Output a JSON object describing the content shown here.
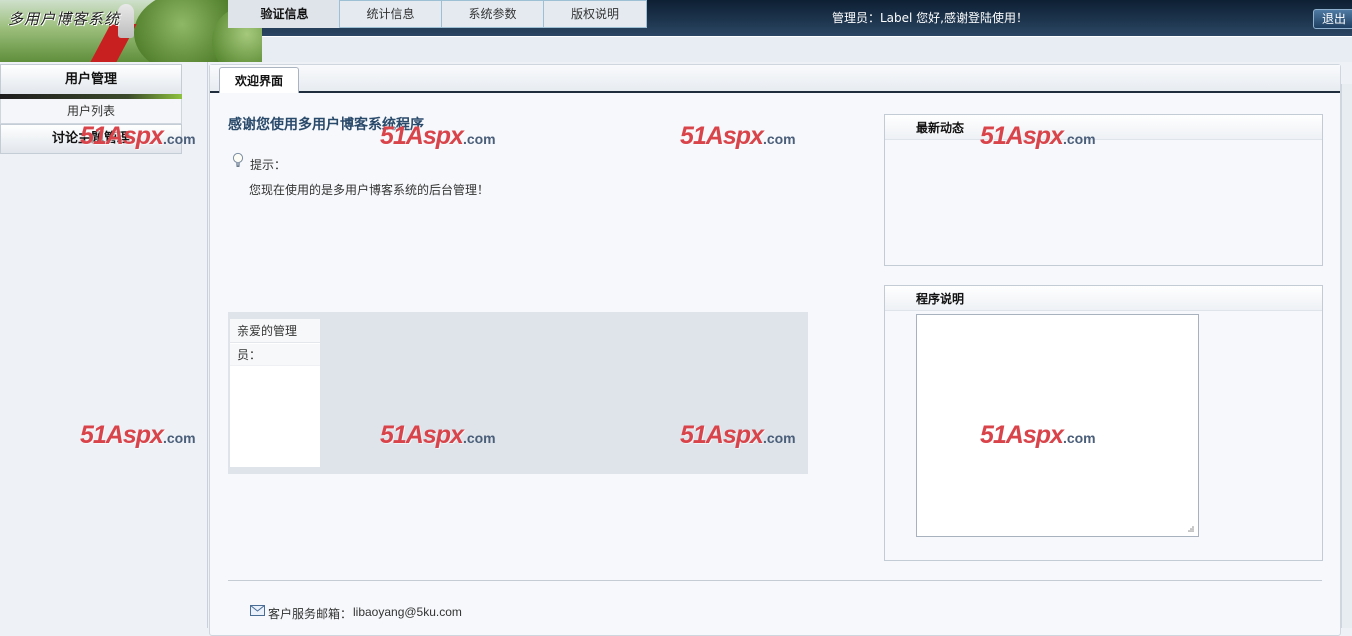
{
  "header": {
    "logo_title": "多用户博客系统",
    "greeting": "管理员：Label 您好,感谢登陆使用！",
    "logout_label": "退出"
  },
  "sidebar": {
    "group_user": "用户管理",
    "item_user_list": "用户列表",
    "group_topic": "讨论主题管理"
  },
  "main": {
    "tab_label": "欢迎界面",
    "welcome_title": "感谢您使用多用户博客系统程序",
    "tip_label": "提示：",
    "tip_text": "您现在使用的是多用户博客系统的后台管理！",
    "tabs": [
      {
        "label": "验证信息",
        "active": true
      },
      {
        "label": "统计信息"
      },
      {
        "label": "系统参数"
      },
      {
        "label": "版权说明"
      }
    ],
    "tab_content": {
      "line1": "亲爱的管理",
      "line2": "员："
    },
    "news_title": "最新动态",
    "program_title": "程序说明",
    "program_notes_value": ""
  },
  "footer": {
    "mail_label": "客户服务邮箱：",
    "mail_value": "libaoyang@5ku.com"
  },
  "watermark": {
    "big": "51Aspx",
    "small": ".com"
  },
  "colors": {
    "header_dark": "#1a3048",
    "accent_title": "#2a4a6b",
    "watermark_red": "#d9444b"
  },
  "icons": {
    "tip": "lightbulb-icon",
    "mail": "envelope-icon"
  }
}
